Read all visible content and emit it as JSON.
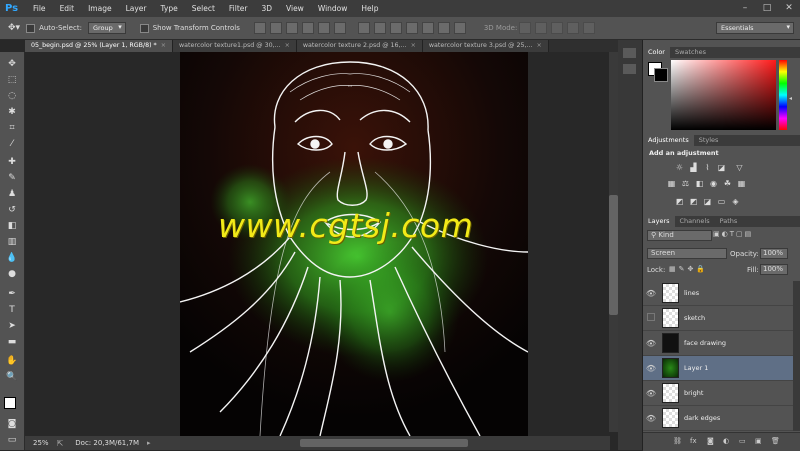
{
  "menubar": {
    "logo": "Ps",
    "items": [
      "File",
      "Edit",
      "Image",
      "Layer",
      "Type",
      "Select",
      "Filter",
      "3D",
      "View",
      "Window",
      "Help"
    ],
    "window_controls": [
      "–",
      "□",
      "✕"
    ]
  },
  "options_bar": {
    "auto_select_label": "Auto-Select:",
    "auto_select_value": "Group",
    "show_transform_label": "Show Transform Controls",
    "mode_3d_label": "3D Mode:",
    "workspace_value": "Essentials"
  },
  "tabs": [
    {
      "label": "05_begin.psd @ 25% (Layer 1, RGB/8) *",
      "close": "×"
    },
    {
      "label": "watercolor texture1.psd @ 30,...",
      "close": "×"
    },
    {
      "label": "watercolor texture 2.psd @ 16,...",
      "close": "×"
    },
    {
      "label": "watercolor texture 3.psd @ 25,...",
      "close": "×"
    }
  ],
  "watermark": "www.cgtsj.com",
  "status": {
    "zoom": "25%",
    "doc": "Doc: 20,3M/61,7M"
  },
  "color_panel": {
    "tabs": [
      "Color",
      "Swatches"
    ]
  },
  "adjustments_panel": {
    "tabs": [
      "Adjustments",
      "Styles"
    ],
    "heading": "Add an adjustment"
  },
  "layers_panel": {
    "tabs": [
      "Layers",
      "Channels",
      "Paths"
    ],
    "filter_kind": "Kind",
    "blend_mode": "Screen",
    "opacity_label": "Opacity:",
    "opacity_value": "100%",
    "lock_label": "Lock:",
    "fill_label": "Fill:",
    "fill_value": "100%",
    "layers": [
      {
        "name": "lines",
        "visible": true,
        "selected": false
      },
      {
        "name": "sketch",
        "visible": false,
        "selected": false
      },
      {
        "name": "face drawing",
        "visible": true,
        "selected": false
      },
      {
        "name": "Layer 1",
        "visible": true,
        "selected": true
      },
      {
        "name": "bright",
        "visible": true,
        "selected": false
      },
      {
        "name": "dark edges",
        "visible": true,
        "selected": false
      }
    ],
    "footer_icons": [
      "link-icon",
      "fx-icon",
      "mask-icon",
      "adjustment-icon",
      "folder-icon",
      "new-layer-icon",
      "trash-icon"
    ]
  },
  "colors": {
    "accent": "#31a8ff",
    "selected_layer": "#5f6f86",
    "watermark": "#f2ea18",
    "glow": "#3fbf2a"
  }
}
